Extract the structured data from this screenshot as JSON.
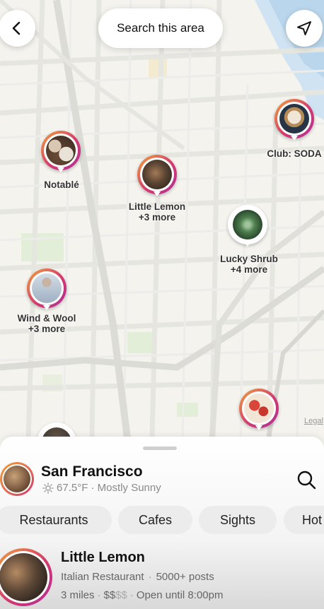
{
  "map": {
    "search_button": "Search this area",
    "legal": "Legal",
    "pins": [
      {
        "label": "Notablé",
        "sub": ""
      },
      {
        "label": "Little Lemon",
        "sub": "+3 more"
      },
      {
        "label": "Club: SODA",
        "sub": ""
      },
      {
        "label": "Lucky Shrub",
        "sub": "+4 more"
      },
      {
        "label": "Wind & Wool",
        "sub": "+3 more"
      },
      {
        "label": "",
        "sub": ""
      },
      {
        "label": "",
        "sub": ""
      }
    ]
  },
  "sheet": {
    "city": "San Francisco",
    "weather": "67.5°F · Mostly Sunny",
    "chips": [
      "Restaurants",
      "Cafes",
      "Sights",
      "Hot"
    ],
    "result": {
      "title": "Little Lemon",
      "category": "Italian Restaurant",
      "posts": "5000+ posts",
      "distance": "3 miles",
      "price_active": "$$",
      "price_inactive": "$$",
      "hours": "Open until 8:00pm"
    }
  },
  "icons": {
    "back": "back-chevron-icon",
    "location": "navigation-arrow-icon",
    "search": "search-icon",
    "weather": "sun-icon"
  }
}
